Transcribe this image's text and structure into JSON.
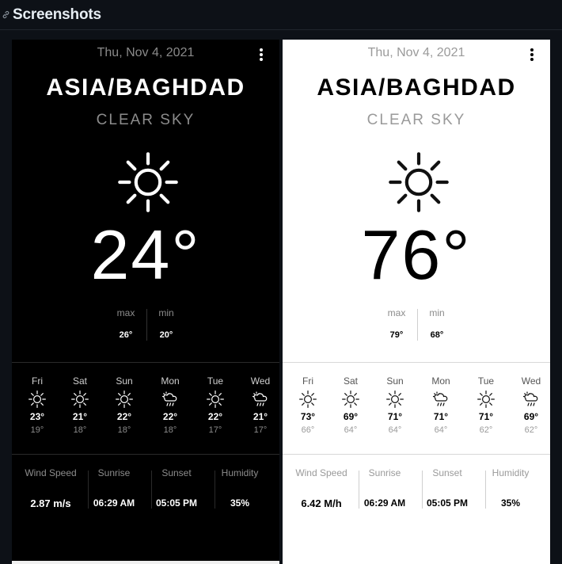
{
  "header": {
    "title": "Screenshots",
    "icon": "link-icon"
  },
  "phones": [
    {
      "theme": "dark",
      "date": "Thu, Nov 4, 2021",
      "city": "ASIA/BAGHDAD",
      "condition": "CLEAR SKY",
      "main_icon": "sun-icon",
      "temp": "24°",
      "max_label": "max",
      "min_label": "min",
      "max": "26°",
      "min": "20°",
      "forecast": [
        {
          "day": "Fri",
          "icon": "sun-icon",
          "hi": "23°",
          "lo": "19°"
        },
        {
          "day": "Sat",
          "icon": "sun-icon",
          "hi": "21°",
          "lo": "18°"
        },
        {
          "day": "Sun",
          "icon": "sun-icon",
          "hi": "22°",
          "lo": "18°"
        },
        {
          "day": "Mon",
          "icon": "rain-cloud-icon",
          "hi": "22°",
          "lo": "18°"
        },
        {
          "day": "Tue",
          "icon": "sun-icon",
          "hi": "22°",
          "lo": "17°"
        },
        {
          "day": "Wed",
          "icon": "rain-cloud-icon",
          "hi": "21°",
          "lo": "17°"
        }
      ],
      "details": [
        {
          "label": "Wind Speed",
          "value": "2.87 m/s"
        },
        {
          "label": "Sunrise",
          "value": "06:29 AM"
        },
        {
          "label": "Sunset",
          "value": "05:05 PM"
        },
        {
          "label": "Humidity",
          "value": "35%"
        }
      ]
    },
    {
      "theme": "light",
      "date": "Thu, Nov 4, 2021",
      "city": "ASIA/BAGHDAD",
      "condition": "CLEAR SKY",
      "main_icon": "sun-icon",
      "temp": "76°",
      "max_label": "max",
      "min_label": "min",
      "max": "79°",
      "min": "68°",
      "forecast": [
        {
          "day": "Fri",
          "icon": "sun-icon",
          "hi": "73°",
          "lo": "66°"
        },
        {
          "day": "Sat",
          "icon": "sun-icon",
          "hi": "69°",
          "lo": "64°"
        },
        {
          "day": "Sun",
          "icon": "sun-icon",
          "hi": "71°",
          "lo": "64°"
        },
        {
          "day": "Mon",
          "icon": "rain-cloud-icon",
          "hi": "71°",
          "lo": "64°"
        },
        {
          "day": "Tue",
          "icon": "sun-icon",
          "hi": "71°",
          "lo": "62°"
        },
        {
          "day": "Wed",
          "icon": "rain-cloud-icon",
          "hi": "69°",
          "lo": "62°"
        }
      ],
      "details": [
        {
          "label": "Wind Speed",
          "value": "6.42 M/h"
        },
        {
          "label": "Sunrise",
          "value": "06:29 AM"
        },
        {
          "label": "Sunset",
          "value": "05:05 PM"
        },
        {
          "label": "Humidity",
          "value": "35%"
        }
      ]
    }
  ],
  "colors": {
    "page_bg": "#0d1117",
    "dark_bg": "#000000",
    "light_bg": "#ffffff"
  }
}
